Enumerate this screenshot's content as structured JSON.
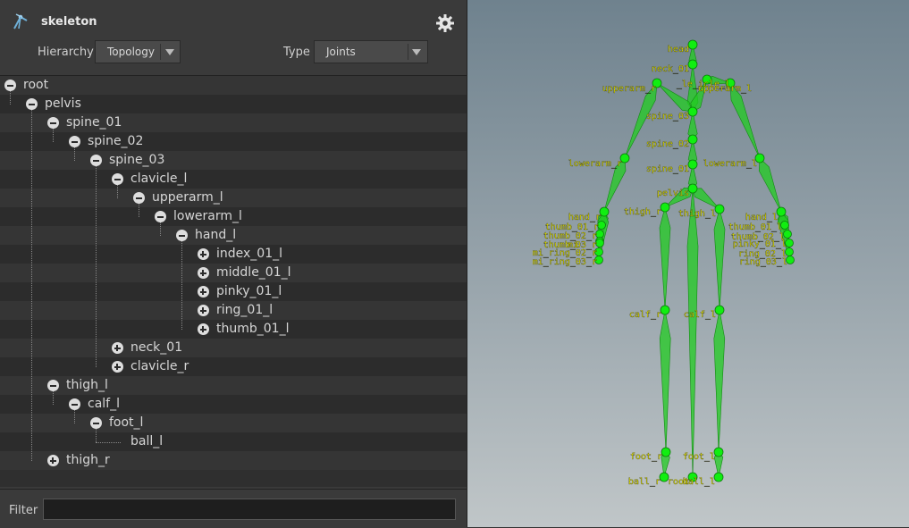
{
  "header": {
    "title": "skeleton",
    "hierarchy_label": "Hierarchy",
    "hierarchy_value": "Topology",
    "type_label": "Type",
    "type_value": "Joints"
  },
  "tree": [
    {
      "label": "root",
      "depth": 0,
      "toggle": "minus"
    },
    {
      "label": "pelvis",
      "depth": 1,
      "toggle": "minus"
    },
    {
      "label": "spine_01",
      "depth": 2,
      "toggle": "minus"
    },
    {
      "label": "spine_02",
      "depth": 3,
      "toggle": "minus"
    },
    {
      "label": "spine_03",
      "depth": 4,
      "toggle": "minus"
    },
    {
      "label": "clavicle_l",
      "depth": 5,
      "toggle": "minus"
    },
    {
      "label": "upperarm_l",
      "depth": 6,
      "toggle": "minus"
    },
    {
      "label": "lowerarm_l",
      "depth": 7,
      "toggle": "minus"
    },
    {
      "label": "hand_l",
      "depth": 8,
      "toggle": "minus"
    },
    {
      "label": "index_01_l",
      "depth": 9,
      "toggle": "plus"
    },
    {
      "label": "middle_01_l",
      "depth": 9,
      "toggle": "plus"
    },
    {
      "label": "pinky_01_l",
      "depth": 9,
      "toggle": "plus"
    },
    {
      "label": "ring_01_l",
      "depth": 9,
      "toggle": "plus"
    },
    {
      "label": "thumb_01_l",
      "depth": 9,
      "toggle": "plus"
    },
    {
      "label": "neck_01",
      "depth": 5,
      "toggle": "plus"
    },
    {
      "label": "clavicle_r",
      "depth": 5,
      "toggle": "plus"
    },
    {
      "label": "thigh_l",
      "depth": 2,
      "toggle": "minus"
    },
    {
      "label": "calf_l",
      "depth": 3,
      "toggle": "minus"
    },
    {
      "label": "foot_l",
      "depth": 4,
      "toggle": "minus"
    },
    {
      "label": "ball_l",
      "depth": 5,
      "toggle": "none"
    },
    {
      "label": "thigh_r",
      "depth": 2,
      "toggle": "plus"
    }
  ],
  "filter": {
    "label": "Filter",
    "value": ""
  },
  "viewport_labels": [
    {
      "text": "head",
      "joint": "head"
    },
    {
      "text": "neck_01",
      "joint": "neck"
    },
    {
      "text": "upperarm_r",
      "joint": "uar"
    },
    {
      "text": "_le_icle_l",
      "joint": "clv"
    },
    {
      "text": "upperarm_l",
      "joint": "ual"
    },
    {
      "text": "spine_03",
      "joint": "s3"
    },
    {
      "text": "spine_02",
      "joint": "s2"
    },
    {
      "text": "spine_01",
      "joint": "s1"
    },
    {
      "text": "lowerarm_r",
      "joint": "lar"
    },
    {
      "text": "lowerarm_l",
      "joint": "lal"
    },
    {
      "text": "pelvis",
      "joint": "pelvis"
    },
    {
      "text": "hand_r",
      "joint": "hr"
    },
    {
      "text": "thigh_r",
      "joint": "tr"
    },
    {
      "text": "thigh_l",
      "joint": "tl"
    },
    {
      "text": "hand_l",
      "joint": "hl"
    },
    {
      "text": "thumb_01_r",
      "joint": "f_r1"
    },
    {
      "text": "thumb_02_r",
      "joint": "f_r2"
    },
    {
      "text": "mi",
      "joint": "f_r3"
    },
    {
      "text": "thumb_03_r",
      "joint": "f_r3b"
    },
    {
      "text": "mi_ring_02_r",
      "joint": "f_r4"
    },
    {
      "text": "mi_ring_03_r",
      "joint": "f_r5"
    },
    {
      "text": "thumb_01_l",
      "joint": "f_l1"
    },
    {
      "text": "thumb_02_l",
      "joint": "f_l2"
    },
    {
      "text": "pinky_01_l",
      "joint": "f_l3"
    },
    {
      "text": "ring_02_l",
      "joint": "f_l4"
    },
    {
      "text": "ring_03_l",
      "joint": "f_l5"
    },
    {
      "text": "calf_r",
      "joint": "cr"
    },
    {
      "text": "calf_l",
      "joint": "cl"
    },
    {
      "text": "foot_r",
      "joint": "fr"
    },
    {
      "text": "foot_l",
      "joint": "fl"
    },
    {
      "text": "ball_r",
      "joint": "br"
    },
    {
      "text": "root",
      "joint": "root"
    },
    {
      "text": "ball_l",
      "joint": "bl"
    }
  ],
  "colors": {
    "bone": "#22cc22",
    "joint": "#11ee11",
    "label": "#ffff00"
  }
}
